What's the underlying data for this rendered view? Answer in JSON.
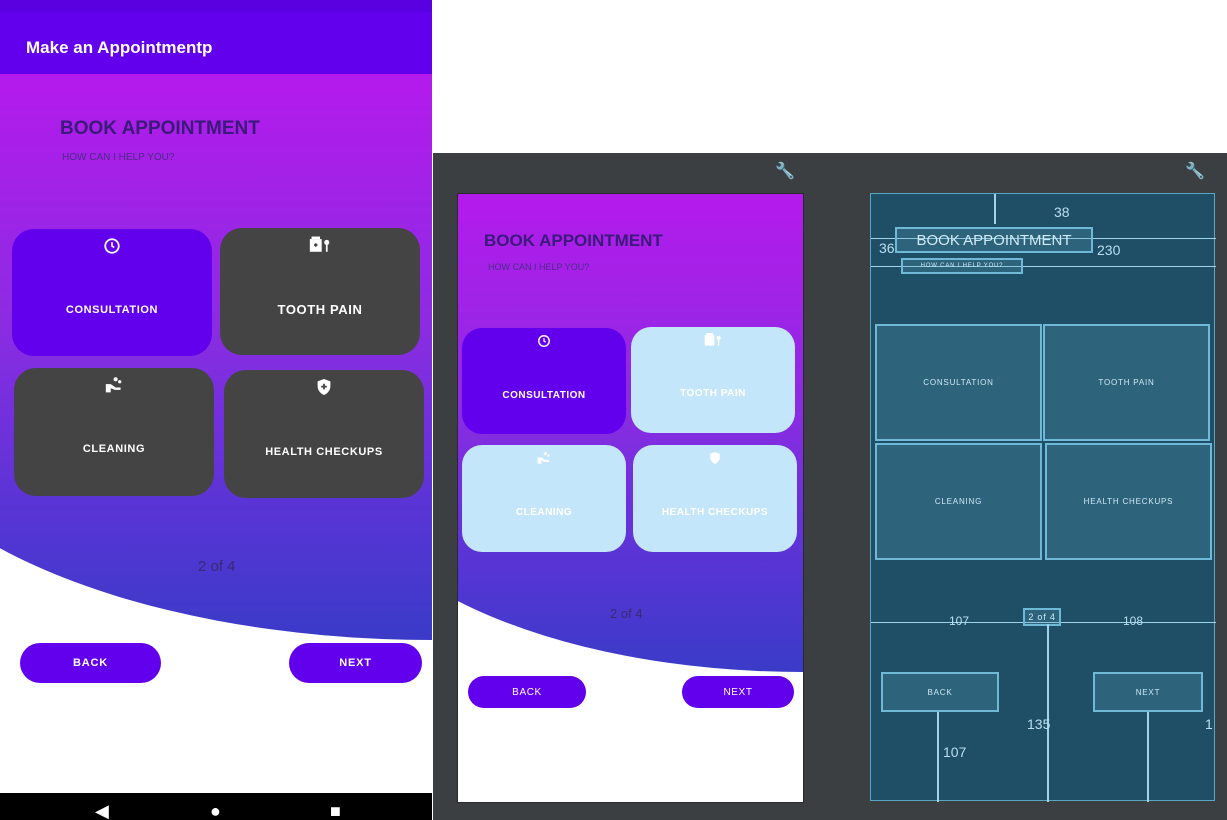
{
  "app_bar": {
    "title": "Make an Appointmentp"
  },
  "hero": {
    "title": "BOOK APPOINTMENT",
    "subtitle": "HOW CAN I HELP YOU?"
  },
  "tiles": [
    {
      "label": "CONSULTATION",
      "icon": "clock-icon"
    },
    {
      "label": "TOOTH PAIN",
      "icon": "tooth-kit-icon"
    },
    {
      "label": "CLEANING",
      "icon": "hand-wash-icon"
    },
    {
      "label": "HEALTH CHECKUPS",
      "icon": "shield-plus-icon"
    }
  ],
  "pager": {
    "text": "2 of 4"
  },
  "buttons": {
    "back": "BACK",
    "next": "NEXT"
  },
  "blueprint": {
    "labels": {
      "margin_top": "38",
      "margin_left": "36",
      "margin_right": "230",
      "pager_left": "107",
      "pager_right": "108",
      "bottom_a": "107",
      "bottom_b": "135",
      "bottom_c": "1"
    }
  },
  "colors": {
    "primary": "#6200ee",
    "tile_dark": "#444444",
    "tile_light": "#c4e6fa",
    "blueprint_bg": "#1f4f66"
  }
}
